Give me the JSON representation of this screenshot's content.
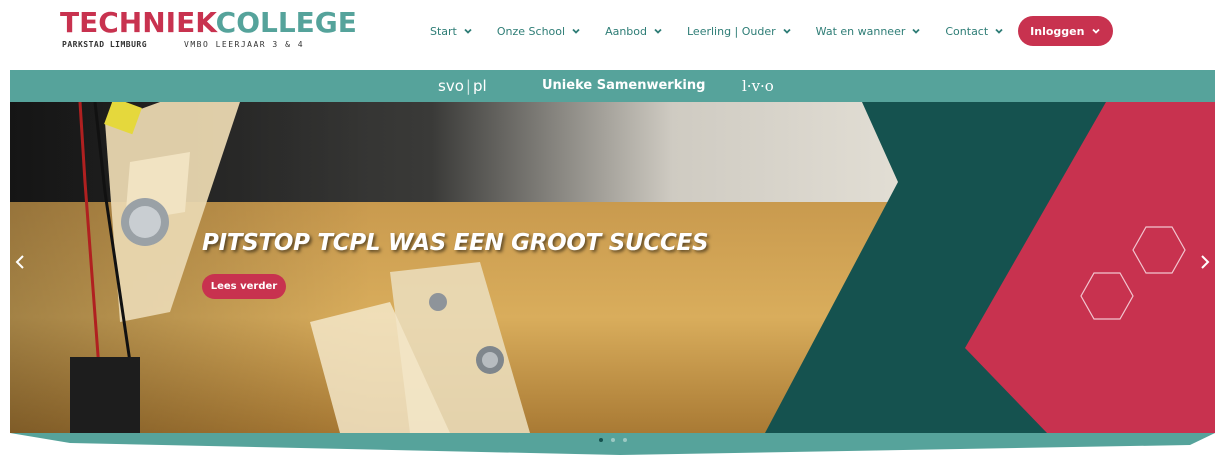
{
  "logo": {
    "part1": "TECH",
    "part2": "NIEK",
    "part3": "COLLEGE",
    "sub_left": "PARKSTAD LIMBURG",
    "sub_right": "VMBO LEERJAAR 3 & 4"
  },
  "nav": {
    "items": [
      {
        "label": "Start"
      },
      {
        "label": "Onze School"
      },
      {
        "label": "Aanbod"
      },
      {
        "label": "Leerling | Ouder"
      },
      {
        "label": "Wat en wanneer"
      },
      {
        "label": "Contact"
      }
    ],
    "login_label": "Inloggen"
  },
  "topbar": {
    "svo_a": "svo",
    "svo_sep": "|",
    "svo_b": "pl",
    "middle": "Unieke Samenwerking",
    "lvo": "l·v·o"
  },
  "hero": {
    "title": "PITSTOP TCPL WAS EEN GROOT SUCCES",
    "button_label": "Lees verder"
  },
  "slider": {
    "prev_icon": "chevron-left-icon",
    "next_icon": "chevron-right-icon",
    "slide_count": 3,
    "active_slide": 1
  },
  "colors": {
    "brand_red": "#c8324f",
    "brand_teal": "#56a39b",
    "dark_teal": "#15524f",
    "nav_text": "#2e7d76"
  }
}
